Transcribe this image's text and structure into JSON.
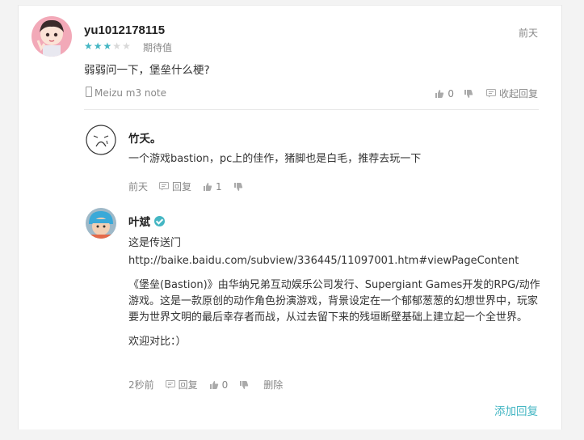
{
  "comment": {
    "user": "yu1012178115",
    "rating": {
      "stars": 3,
      "max": 5,
      "label": "期待值"
    },
    "time": "前天",
    "text": "弱弱问一下，堡垒什么梗?",
    "device": "Meizu m3 note",
    "actions": {
      "like_count": "0",
      "collapse_label": "收起回复"
    }
  },
  "replies": [
    {
      "user": "竹夭。",
      "verified": false,
      "paragraphs": [
        "一个游戏bastion，pc上的佳作，猪脚也是白毛，推荐去玩一下"
      ],
      "time": "前天",
      "reply_label": "回复",
      "like_count": "1"
    },
    {
      "user": "叶斌",
      "verified": true,
      "paragraphs": [
        "这是传送门",
        "http://baike.baidu.com/subview/336445/11097001.htm#viewPageContent",
        "《堡垒(Bastion)》由华纳兄弟互动娱乐公司发行、Supergiant Games开发的RPG/动作游戏。这是一款原创的动作角色扮演游戏，背景设定在一个郁郁葱葱的幻想世界中，玩家要为世界文明的最后幸存者而战，从过去留下来的残垣断壁基础上建立起一个全世界。",
        "欢迎对比：）"
      ],
      "time": "2秒前",
      "reply_label": "回复",
      "like_count": "0",
      "delete_label": "删除"
    }
  ],
  "add_reply_label": "添加回复",
  "colors": {
    "accent": "#44b6c3",
    "muted": "#888888"
  },
  "icons": [
    "phone-icon",
    "thumb-up-icon",
    "thumb-down-icon",
    "comment-icon",
    "verified-icon"
  ]
}
